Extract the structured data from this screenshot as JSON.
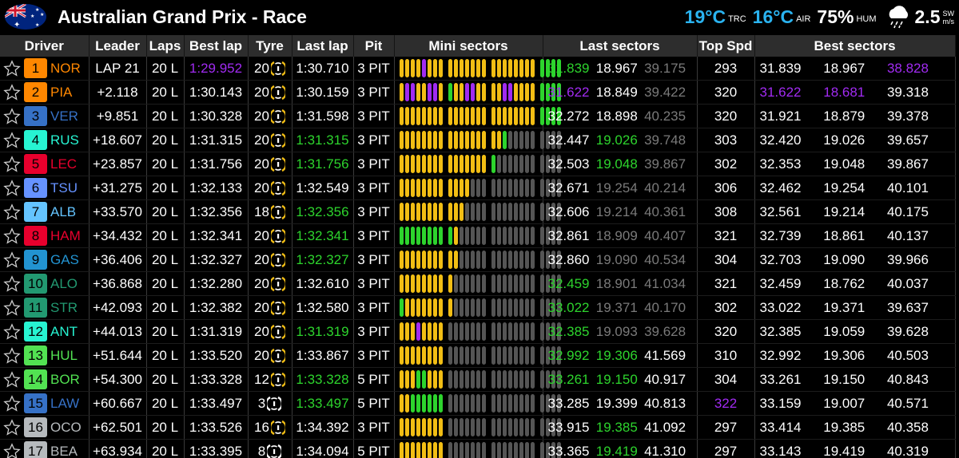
{
  "header": {
    "title": "Australian Grand Prix - Race",
    "weather": {
      "track_temp": "19°C",
      "track_label": "TRC",
      "air_temp": "16°C",
      "air_label": "AIR",
      "humidity": "75%",
      "humidity_label": "HUM",
      "wind": "2.5",
      "wind_dir": "SW",
      "wind_unit": "m/s"
    }
  },
  "columns": [
    "Driver",
    "Leader",
    "Laps",
    "Best lap",
    "Tyre",
    "Last lap",
    "Pit",
    "Mini sectors",
    "Last sectors",
    "Top Spd",
    "Best sectors"
  ],
  "colors": {
    "green": "#2dd42d",
    "purple": "#a12bf2",
    "yellow": "#f2be14",
    "grey": "#555555",
    "white": "#ffffff",
    "tyre_medium": "#f2be14",
    "tyre_hard": "#ffffff"
  },
  "rows": [
    {
      "pos": "1",
      "code": "NOR",
      "team_color": "#ff8700",
      "code_color": "#ff8700",
      "pos_text_color": "#000",
      "leader": "LAP 21",
      "laps": "20 L",
      "best_lap": "1:29.952",
      "best_lap_c": "purple",
      "tyre_age": "20",
      "tyre": "medium",
      "last_lap": "1:30.710",
      "last_lap_c": "white",
      "pit": "3 PIT",
      "ms": "YYYYPYYY|YYYYYYY|YYYYYYYY|GGGG",
      "ls": [
        "31.839",
        "18.967",
        "39.175"
      ],
      "ls_c": [
        "green",
        "white",
        "grey"
      ],
      "top": "293",
      "top_c": "white",
      "bs": [
        "31.839",
        "18.967",
        "38.828"
      ],
      "bs_c": [
        "white",
        "white",
        "purple"
      ]
    },
    {
      "pos": "2",
      "code": "PIA",
      "team_color": "#ff8700",
      "code_color": "#ff8700",
      "pos_text_color": "#000",
      "leader": "+2.118",
      "laps": "20 L",
      "best_lap": "1:30.143",
      "best_lap_c": "white",
      "tyre_age": "20",
      "tyre": "medium",
      "last_lap": "1:30.159",
      "last_lap_c": "white",
      "pit": "3 PIT",
      "ms": "YPPYYPPY|GYYPPYY|YYPPYYYY|GGGG",
      "ls": [
        "31.622",
        "18.849",
        "39.422"
      ],
      "ls_c": [
        "purple",
        "white",
        "grey"
      ],
      "top": "320",
      "top_c": "white",
      "bs": [
        "31.622",
        "18.681",
        "39.318"
      ],
      "bs_c": [
        "purple",
        "purple",
        "white"
      ]
    },
    {
      "pos": "3",
      "code": "VER",
      "team_color": "#3671c6",
      "code_color": "#3671c6",
      "pos_text_color": "#000",
      "leader": "+9.851",
      "laps": "20 L",
      "best_lap": "1:30.328",
      "best_lap_c": "white",
      "tyre_age": "20",
      "tyre": "medium",
      "last_lap": "1:31.598",
      "last_lap_c": "white",
      "pit": "3 PIT",
      "ms": "YYYYYYYY|YYYYYYY|YYYYYYYY|GGGG",
      "ls": [
        "32.272",
        "18.898",
        "40.235"
      ],
      "ls_c": [
        "white",
        "white",
        "grey"
      ],
      "top": "320",
      "top_c": "white",
      "bs": [
        "31.921",
        "18.879",
        "39.378"
      ],
      "bs_c": [
        "white",
        "white",
        "white"
      ]
    },
    {
      "pos": "4",
      "code": "RUS",
      "team_color": "#27f4d2",
      "code_color": "#27f4d2",
      "pos_text_color": "#000",
      "leader": "+18.607",
      "laps": "20 L",
      "best_lap": "1:31.315",
      "best_lap_c": "white",
      "tyre_age": "20",
      "tyre": "medium",
      "last_lap": "1:31.315",
      "last_lap_c": "green",
      "pit": "3 PIT",
      "ms": "YYYYYYYY|YYYYYYY|YYGXXXXX|XXXX",
      "ls": [
        "32.447",
        "19.026",
        "39.748"
      ],
      "ls_c": [
        "white",
        "green",
        "grey"
      ],
      "top": "303",
      "top_c": "white",
      "bs": [
        "32.420",
        "19.026",
        "39.657"
      ],
      "bs_c": [
        "white",
        "white",
        "white"
      ]
    },
    {
      "pos": "5",
      "code": "LEC",
      "team_color": "#e8002d",
      "code_color": "#e8002d",
      "pos_text_color": "#000",
      "leader": "+23.857",
      "laps": "20 L",
      "best_lap": "1:31.756",
      "best_lap_c": "white",
      "tyre_age": "20",
      "tyre": "medium",
      "last_lap": "1:31.756",
      "last_lap_c": "green",
      "pit": "3 PIT",
      "ms": "YYYYYYYY|YYYYYYY|GXXXXXXX|XXXX",
      "ls": [
        "32.503",
        "19.048",
        "39.867"
      ],
      "ls_c": [
        "white",
        "green",
        "grey"
      ],
      "top": "302",
      "top_c": "white",
      "bs": [
        "32.353",
        "19.048",
        "39.867"
      ],
      "bs_c": [
        "white",
        "white",
        "white"
      ]
    },
    {
      "pos": "6",
      "code": "TSU",
      "team_color": "#6692ff",
      "code_color": "#6692ff",
      "pos_text_color": "#000",
      "leader": "+31.275",
      "laps": "20 L",
      "best_lap": "1:32.133",
      "best_lap_c": "white",
      "tyre_age": "20",
      "tyre": "medium",
      "last_lap": "1:32.549",
      "last_lap_c": "white",
      "pit": "3 PIT",
      "ms": "YYYYYYYY|YYYYXXX|XXXXXXXX|XXXX",
      "ls": [
        "32.671",
        "19.254",
        "40.214"
      ],
      "ls_c": [
        "white",
        "grey",
        "grey"
      ],
      "top": "306",
      "top_c": "white",
      "bs": [
        "32.462",
        "19.254",
        "40.101"
      ],
      "bs_c": [
        "white",
        "white",
        "white"
      ]
    },
    {
      "pos": "7",
      "code": "ALB",
      "team_color": "#64c4ff",
      "code_color": "#64c4ff",
      "pos_text_color": "#000",
      "leader": "+33.570",
      "laps": "20 L",
      "best_lap": "1:32.356",
      "best_lap_c": "white",
      "tyre_age": "18",
      "tyre": "medium",
      "last_lap": "1:32.356",
      "last_lap_c": "green",
      "pit": "3 PIT",
      "ms": "YYYYYYYY|YYYXXXX|XXXXXXXX|XXXX",
      "ls": [
        "32.606",
        "19.214",
        "40.361"
      ],
      "ls_c": [
        "white",
        "grey",
        "grey"
      ],
      "top": "308",
      "top_c": "white",
      "bs": [
        "32.561",
        "19.214",
        "40.175"
      ],
      "bs_c": [
        "white",
        "white",
        "white"
      ]
    },
    {
      "pos": "8",
      "code": "HAM",
      "team_color": "#e8002d",
      "code_color": "#e8002d",
      "pos_text_color": "#000",
      "leader": "+34.432",
      "laps": "20 L",
      "best_lap": "1:32.341",
      "best_lap_c": "white",
      "tyre_age": "20",
      "tyre": "medium",
      "last_lap": "1:32.341",
      "last_lap_c": "green",
      "pit": "3 PIT",
      "ms": "GGGGGGGG|GYXXXXX|XXXXXXXX|XXXX",
      "ls": [
        "32.861",
        "18.909",
        "40.407"
      ],
      "ls_c": [
        "white",
        "grey",
        "grey"
      ],
      "top": "321",
      "top_c": "white",
      "bs": [
        "32.739",
        "18.861",
        "40.137"
      ],
      "bs_c": [
        "white",
        "white",
        "white"
      ]
    },
    {
      "pos": "9",
      "code": "GAS",
      "team_color": "#2293d1",
      "code_color": "#2293d1",
      "pos_text_color": "#000",
      "leader": "+36.406",
      "laps": "20 L",
      "best_lap": "1:32.327",
      "best_lap_c": "white",
      "tyre_age": "20",
      "tyre": "medium",
      "last_lap": "1:32.327",
      "last_lap_c": "green",
      "pit": "3 PIT",
      "ms": "YYYYYYYY|YYXXXXX|XXXXXXXX|XXXX",
      "ls": [
        "32.860",
        "19.090",
        "40.534"
      ],
      "ls_c": [
        "white",
        "grey",
        "grey"
      ],
      "top": "304",
      "top_c": "white",
      "bs": [
        "32.703",
        "19.090",
        "39.966"
      ],
      "bs_c": [
        "white",
        "white",
        "white"
      ]
    },
    {
      "pos": "10",
      "code": "ALO",
      "team_color": "#229971",
      "code_color": "#229971",
      "pos_text_color": "#000",
      "leader": "+36.868",
      "laps": "20 L",
      "best_lap": "1:32.280",
      "best_lap_c": "white",
      "tyre_age": "20",
      "tyre": "medium",
      "last_lap": "1:32.610",
      "last_lap_c": "white",
      "pit": "3 PIT",
      "ms": "YYYYYYYY|YXXXXXX|XXXXXXXX|XXXX",
      "ls": [
        "32.459",
        "18.901",
        "41.034"
      ],
      "ls_c": [
        "green",
        "grey",
        "grey"
      ],
      "top": "321",
      "top_c": "white",
      "bs": [
        "32.459",
        "18.762",
        "40.037"
      ],
      "bs_c": [
        "white",
        "white",
        "white"
      ]
    },
    {
      "pos": "11",
      "code": "STR",
      "team_color": "#229971",
      "code_color": "#229971",
      "pos_text_color": "#000",
      "leader": "+42.093",
      "laps": "20 L",
      "best_lap": "1:32.382",
      "best_lap_c": "white",
      "tyre_age": "20",
      "tyre": "medium",
      "last_lap": "1:32.580",
      "last_lap_c": "white",
      "pit": "3 PIT",
      "ms": "GYYYYYYY|YXXXXXX|XXXXXXXX|XXXX",
      "ls": [
        "33.022",
        "19.371",
        "40.170"
      ],
      "ls_c": [
        "green",
        "grey",
        "grey"
      ],
      "top": "302",
      "top_c": "white",
      "bs": [
        "33.022",
        "19.371",
        "39.637"
      ],
      "bs_c": [
        "white",
        "white",
        "white"
      ]
    },
    {
      "pos": "12",
      "code": "ANT",
      "team_color": "#27f4d2",
      "code_color": "#27f4d2",
      "pos_text_color": "#000",
      "leader": "+44.013",
      "laps": "20 L",
      "best_lap": "1:31.319",
      "best_lap_c": "white",
      "tyre_age": "20",
      "tyre": "medium",
      "last_lap": "1:31.319",
      "last_lap_c": "green",
      "pit": "3 PIT",
      "ms": "YYYPYYYY|XXXXXXX|XXXXXXXX|XXXX",
      "ls": [
        "32.385",
        "19.093",
        "39.628"
      ],
      "ls_c": [
        "green",
        "grey",
        "grey"
      ],
      "top": "320",
      "top_c": "white",
      "bs": [
        "32.385",
        "19.059",
        "39.628"
      ],
      "bs_c": [
        "white",
        "white",
        "white"
      ]
    },
    {
      "pos": "13",
      "code": "HUL",
      "team_color": "#52e252",
      "code_color": "#52e252",
      "pos_text_color": "#000",
      "leader": "+51.644",
      "laps": "20 L",
      "best_lap": "1:33.520",
      "best_lap_c": "white",
      "tyre_age": "20",
      "tyre": "medium",
      "last_lap": "1:33.867",
      "last_lap_c": "white",
      "pit": "3 PIT",
      "ms": "YYYYYYYY|XXXXXXX|XXXXXXXX|XXXX",
      "ls": [
        "32.992",
        "19.306",
        "41.569"
      ],
      "ls_c": [
        "green",
        "green",
        "white"
      ],
      "top": "310",
      "top_c": "white",
      "bs": [
        "32.992",
        "19.306",
        "40.503"
      ],
      "bs_c": [
        "white",
        "white",
        "white"
      ]
    },
    {
      "pos": "14",
      "code": "BOR",
      "team_color": "#52e252",
      "code_color": "#52e252",
      "pos_text_color": "#000",
      "leader": "+54.300",
      "laps": "20 L",
      "best_lap": "1:33.328",
      "best_lap_c": "white",
      "tyre_age": "12",
      "tyre": "medium",
      "last_lap": "1:33.328",
      "last_lap_c": "green",
      "pit": "5 PIT",
      "ms": "YYYGGYYY|XXXXXXX|XXXXXXXX|XXXX",
      "ls": [
        "33.261",
        "19.150",
        "40.917"
      ],
      "ls_c": [
        "green",
        "green",
        "white"
      ],
      "top": "304",
      "top_c": "white",
      "bs": [
        "33.261",
        "19.150",
        "40.843"
      ],
      "bs_c": [
        "white",
        "white",
        "white"
      ]
    },
    {
      "pos": "15",
      "code": "LAW",
      "team_color": "#3671c6",
      "code_color": "#3671c6",
      "pos_text_color": "#000",
      "leader": "+60.667",
      "laps": "20 L",
      "best_lap": "1:33.497",
      "best_lap_c": "white",
      "tyre_age": "3",
      "tyre": "hard",
      "last_lap": "1:33.497",
      "last_lap_c": "green",
      "pit": "5 PIT",
      "ms": "YYGGGGGG|XXXXXXX|XXXXXXXX|XXXX",
      "ls": [
        "33.285",
        "19.399",
        "40.813"
      ],
      "ls_c": [
        "white",
        "white",
        "white"
      ],
      "top": "322",
      "top_c": "purple",
      "bs": [
        "33.159",
        "19.007",
        "40.571"
      ],
      "bs_c": [
        "white",
        "white",
        "white"
      ]
    },
    {
      "pos": "16",
      "code": "OCO",
      "team_color": "#b6babd",
      "code_color": "#b6babd",
      "pos_text_color": "#000",
      "leader": "+62.501",
      "laps": "20 L",
      "best_lap": "1:33.526",
      "best_lap_c": "white",
      "tyre_age": "16",
      "tyre": "medium",
      "last_lap": "1:34.392",
      "last_lap_c": "white",
      "pit": "3 PIT",
      "ms": "YYYYYYYY|XXXXXXX|XXXXXXXX|XXXX",
      "ls": [
        "33.915",
        "19.385",
        "41.092"
      ],
      "ls_c": [
        "white",
        "green",
        "white"
      ],
      "top": "297",
      "top_c": "white",
      "bs": [
        "33.414",
        "19.385",
        "40.358"
      ],
      "bs_c": [
        "white",
        "white",
        "white"
      ]
    },
    {
      "pos": "17",
      "code": "BEA",
      "team_color": "#b6babd",
      "code_color": "#b6babd",
      "pos_text_color": "#000",
      "leader": "+63.934",
      "laps": "20 L",
      "best_lap": "1:33.395",
      "best_lap_c": "white",
      "tyre_age": "8",
      "tyre": "hard",
      "last_lap": "1:34.094",
      "last_lap_c": "white",
      "pit": "5 PIT",
      "ms": "YYYYYYYY|XXXXXXX|XXXXXXXX|XXXX",
      "ls": [
        "33.365",
        "19.419",
        "41.310"
      ],
      "ls_c": [
        "white",
        "green",
        "white"
      ],
      "top": "297",
      "top_c": "white",
      "bs": [
        "33.143",
        "19.419",
        "40.319"
      ],
      "bs_c": [
        "white",
        "white",
        "white"
      ]
    }
  ]
}
